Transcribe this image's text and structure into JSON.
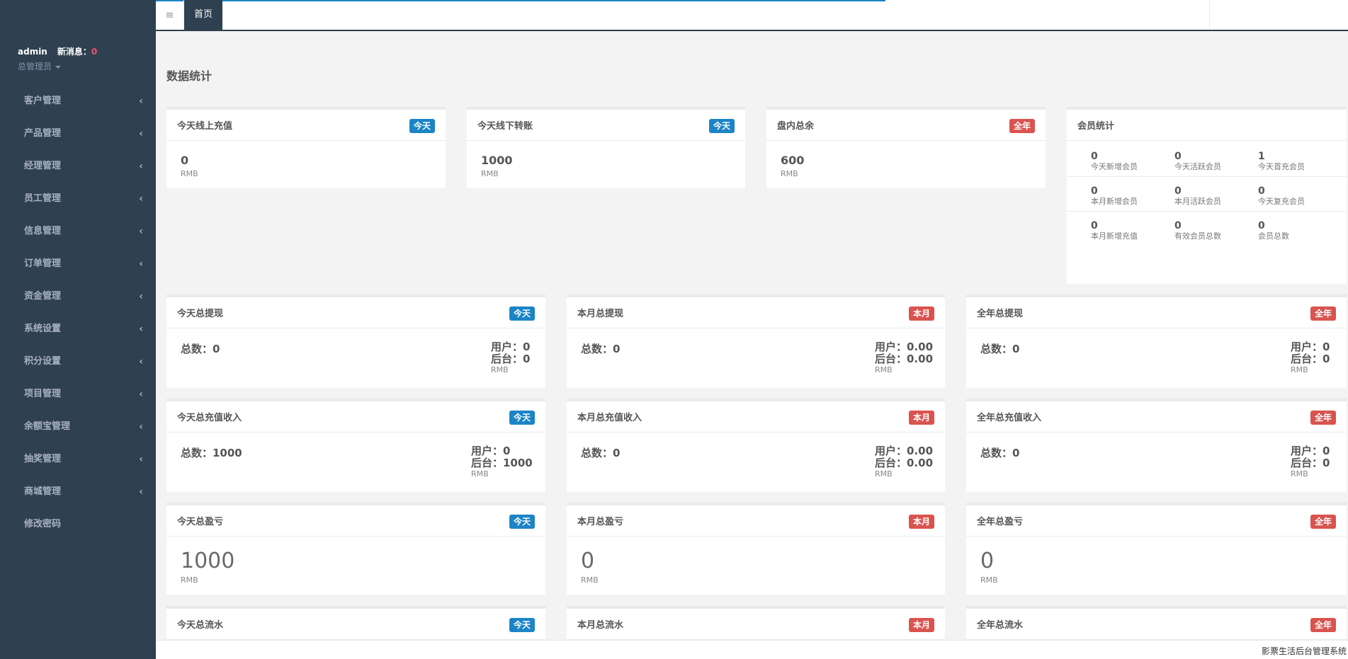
{
  "sidebar": {
    "username": "admin",
    "msg_label": "新消息：",
    "msg_count": "0",
    "role": "总管理员",
    "items": [
      {
        "label": "客户管理",
        "arrow": "‹"
      },
      {
        "label": "产品管理",
        "arrow": "‹"
      },
      {
        "label": "经理管理",
        "arrow": "‹"
      },
      {
        "label": "员工管理",
        "arrow": "‹"
      },
      {
        "label": "信息管理",
        "arrow": "‹"
      },
      {
        "label": "订单管理",
        "arrow": "‹"
      },
      {
        "label": "资金管理",
        "arrow": "‹"
      },
      {
        "label": "系统设置",
        "arrow": "‹"
      },
      {
        "label": "积分设置",
        "arrow": "‹"
      },
      {
        "label": "项目管理",
        "arrow": "‹"
      },
      {
        "label": "余额宝管理",
        "arrow": "‹"
      },
      {
        "label": "抽奖管理",
        "arrow": "‹"
      },
      {
        "label": "商城管理",
        "arrow": "‹"
      },
      {
        "label": "修改密码",
        "arrow": ""
      }
    ]
  },
  "topbar": {
    "menu_icon": "≡",
    "home_tab": "首页"
  },
  "page_title": "数据统计",
  "top_cards": [
    {
      "title": "今天线上充值",
      "badge": "今天",
      "value": "0",
      "unit": "RMB"
    },
    {
      "title": "今天线下转账",
      "badge": "今天",
      "value": "1000",
      "unit": "RMB"
    },
    {
      "title": "盘内总余",
      "badge": "全年",
      "value": "600",
      "unit": "RMB"
    }
  ],
  "member": {
    "title": "会员统计",
    "cells": [
      {
        "value": "0",
        "label": "今天新增会员"
      },
      {
        "value": "0",
        "label": "今天活跃会员"
      },
      {
        "value": "1",
        "label": "今天首充会员"
      },
      {
        "value": "0",
        "label": "本月新增会员"
      },
      {
        "value": "0",
        "label": "本月活跃会员"
      },
      {
        "value": "0",
        "label": "今天复充会员"
      },
      {
        "value": "0",
        "label": "本月新增充值"
      },
      {
        "value": "0",
        "label": "有效会员总数"
      },
      {
        "value": "0",
        "label": "会员总数"
      }
    ]
  },
  "withdraw": [
    {
      "title": "今天总提现",
      "badge": "今天",
      "total": "总数：0",
      "user": "用户：0",
      "backend": "后台：0",
      "unit": "RMB"
    },
    {
      "title": "本月总提现",
      "badge": "本月",
      "total": "总数：0",
      "user": "用户：0.00",
      "backend": "后台：0.00",
      "unit": "RMB"
    },
    {
      "title": "全年总提现",
      "badge": "全年",
      "total": "总数：0",
      "user": "用户：0",
      "backend": "后台：0",
      "unit": "RMB"
    }
  ],
  "recharge": [
    {
      "title": "今天总充值收入",
      "badge": "今天",
      "total": "总数：1000",
      "user": "用户：0",
      "backend": "后台：1000",
      "unit": "RMB"
    },
    {
      "title": "本月总充值收入",
      "badge": "本月",
      "total": "总数：0",
      "user": "用户：0.00",
      "backend": "后台：0.00",
      "unit": "RMB"
    },
    {
      "title": "全年总充值收入",
      "badge": "全年",
      "total": "总数：0",
      "user": "用户：0",
      "backend": "后台：0",
      "unit": "RMB"
    }
  ],
  "profit": [
    {
      "title": "今天总盈亏",
      "badge": "今天",
      "value": "1000",
      "unit": "RMB"
    },
    {
      "title": "本月总盈亏",
      "badge": "本月",
      "value": "0",
      "unit": "RMB"
    },
    {
      "title": "全年总盈亏",
      "badge": "全年",
      "value": "0",
      "unit": "RMB"
    }
  ],
  "flow": [
    {
      "title": "今天总流水",
      "badge": "今天"
    },
    {
      "title": "本月总流水",
      "badge": "本月"
    },
    {
      "title": "全年总流水",
      "badge": "全年"
    }
  ],
  "footer": "影票生活后台管理系统",
  "colors": {
    "sidebar": "#2f4050",
    "badge_blue": "#1c84c6",
    "badge_red": "#d9534f",
    "msg_count": "#ed5565"
  }
}
